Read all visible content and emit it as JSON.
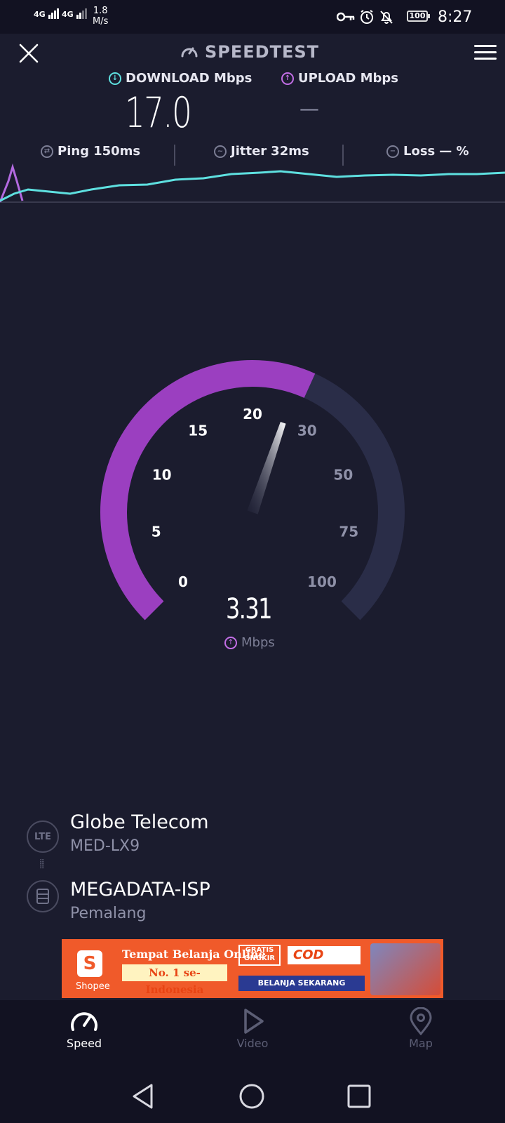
{
  "status_bar": {
    "signal1": "4G",
    "signal2": "4G",
    "net_speed_value": "1.8",
    "net_speed_unit": "M/s",
    "battery": "100",
    "time": "8:27"
  },
  "header": {
    "title": "SPEEDTEST"
  },
  "results": {
    "download_label": "DOWNLOAD Mbps",
    "upload_label": "UPLOAD Mbps",
    "download_value": "17.0",
    "upload_value": "—"
  },
  "metrics": {
    "ping_label": "Ping",
    "ping_value": "150ms",
    "jitter_label": "Jitter",
    "jitter_value": "32ms",
    "loss_label": "Loss",
    "loss_value": "— %"
  },
  "gauge": {
    "ticks": [
      "0",
      "5",
      "10",
      "15",
      "20",
      "30",
      "50",
      "75",
      "100"
    ],
    "current_value": "3.31",
    "unit": "Mbps",
    "progress_fraction": 0.59,
    "colors": {
      "active": "#9b3fc0",
      "track": "#2a2d48"
    }
  },
  "connection": {
    "network_badge": "LTE",
    "provider": "Globe Telecom",
    "device": "MED-LX9",
    "isp": "MEGADATA-ISP",
    "location": "Pemalang"
  },
  "ad": {
    "brand": "Shopee",
    "line1": "Tempat Belanja Online",
    "line2": "No. 1 se-Indonesia",
    "gratis": "GRATIS ONGKIR",
    "cod": "COD",
    "cta": "BELANJA SEKARANG"
  },
  "bottom_nav": {
    "items": [
      {
        "label": "Speed",
        "icon": "speedometer-icon",
        "active": true
      },
      {
        "label": "Video",
        "icon": "play-icon",
        "active": false
      },
      {
        "label": "Map",
        "icon": "map-pin-icon",
        "active": false
      }
    ]
  },
  "colors": {
    "background": "#1b1c2e",
    "download_accent": "#5ee0e0",
    "upload_accent": "#c36ee6",
    "gauge_purple": "#9b3fc0"
  }
}
